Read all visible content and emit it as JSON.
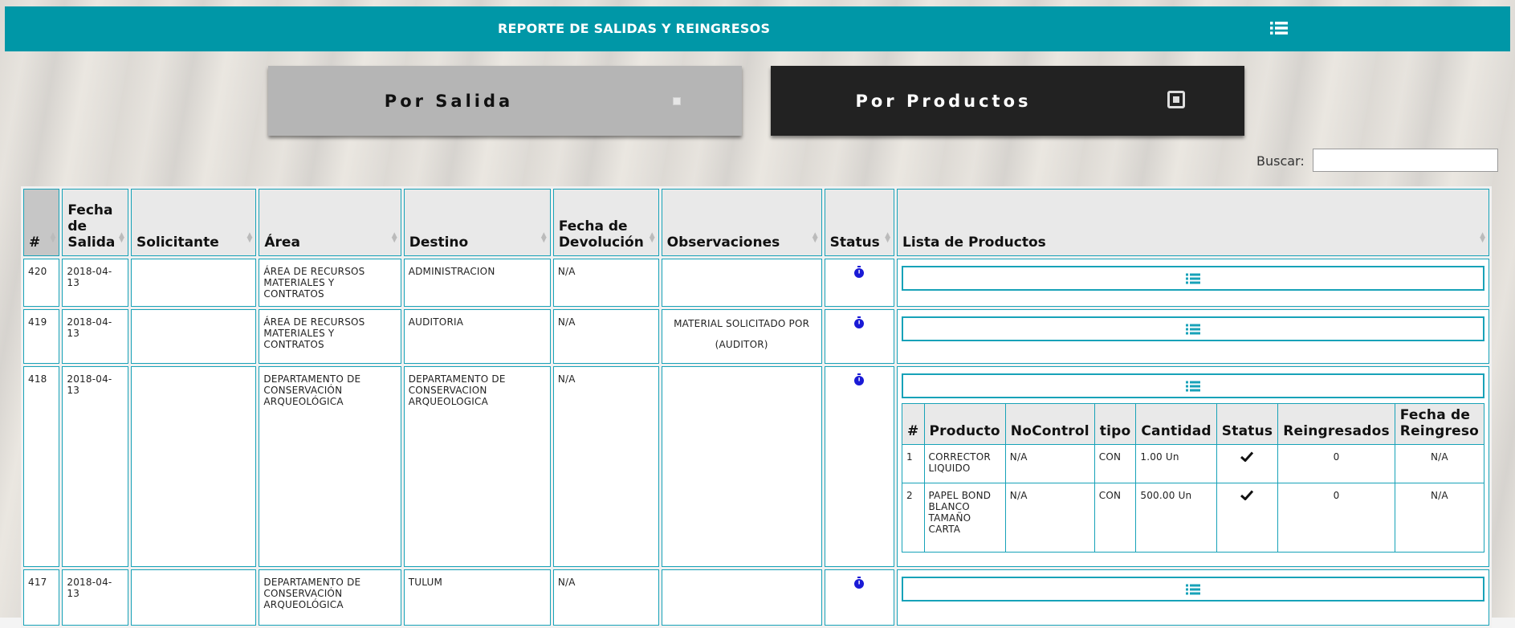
{
  "header": {
    "title": "REPORTE DE SALIDAS Y REINGRESOS"
  },
  "tabs": {
    "por_salida": "Por Salida",
    "por_productos": "Por Productos"
  },
  "search": {
    "label": "Buscar:",
    "value": ""
  },
  "table": {
    "headers": {
      "num": "#",
      "fecha_salida": "Fecha de Salida",
      "solicitante": "Solicitante",
      "area": "Área",
      "destino": "Destino",
      "fecha_devolucion": "Fecha de Devolución",
      "observaciones": "Observaciones",
      "status": "Status",
      "lista": "Lista de Productos"
    },
    "rows": [
      {
        "num": "420",
        "fecha": "2018-04-13",
        "solicitante": "",
        "area": "ÁREA DE RECURSOS MATERIALES Y CONTRATOS",
        "destino": "ADMINISTRACION",
        "devolucion": "N/A",
        "observaciones": ""
      },
      {
        "num": "419",
        "fecha": "2018-04-13",
        "solicitante": "",
        "area": "ÁREA DE RECURSOS MATERIALES Y CONTRATOS",
        "destino": "AUDITORIA",
        "devolucion": "N/A",
        "observaciones_1": "MATERIAL SOLICITADO POR",
        "observaciones_2": "(AUDITOR)"
      },
      {
        "num": "418",
        "fecha": "2018-04-13",
        "solicitante": "",
        "area": "DEPARTAMENTO DE CONSERVACIÓN ARQUEOLÓGICA",
        "destino": "DEPARTAMENTO DE CONSERVACION ARQUEOLOGICA",
        "devolucion": "N/A",
        "observaciones": ""
      },
      {
        "num": "417",
        "fecha": "2018-04-13",
        "solicitante": "",
        "area": "DEPARTAMENTO DE CONSERVACIÓN ARQUEOLÓGICA",
        "destino": "TULUM",
        "devolucion": "N/A",
        "observaciones": ""
      }
    ]
  },
  "products": {
    "headers": {
      "num": "#",
      "producto": "Producto",
      "nocontrol": "NoControl",
      "tipo": "tipo",
      "cantidad": "Cantidad",
      "status": "Status",
      "reingresados": "Reingresados",
      "fecha_reingreso": "Fecha de Reingreso"
    },
    "rows": [
      {
        "num": "1",
        "producto": "CORRECTOR LIQUIDO",
        "nocontrol": "N/A",
        "tipo": "CON",
        "cantidad": "1.00 Un",
        "reingresados": "0",
        "fecha_reingreso": "N/A"
      },
      {
        "num": "2",
        "producto": "PAPEL BOND BLANCO TAMAÑO CARTA",
        "nocontrol": "N/A",
        "tipo": "CON",
        "cantidad": "500.00 Un",
        "reingresados": "0",
        "fecha_reingreso": "N/A"
      }
    ]
  },
  "colors": {
    "teal": "#0097a7",
    "border": "#17a2b8",
    "timer": "#1a1ad6",
    "status_ok_bg": "#b3ffc6",
    "dark_button": "#222222"
  },
  "icons": {
    "header_menu": "list-icon",
    "row_status": "stopwatch-icon",
    "product_list": "list-icon",
    "product_status": "check-icon"
  }
}
